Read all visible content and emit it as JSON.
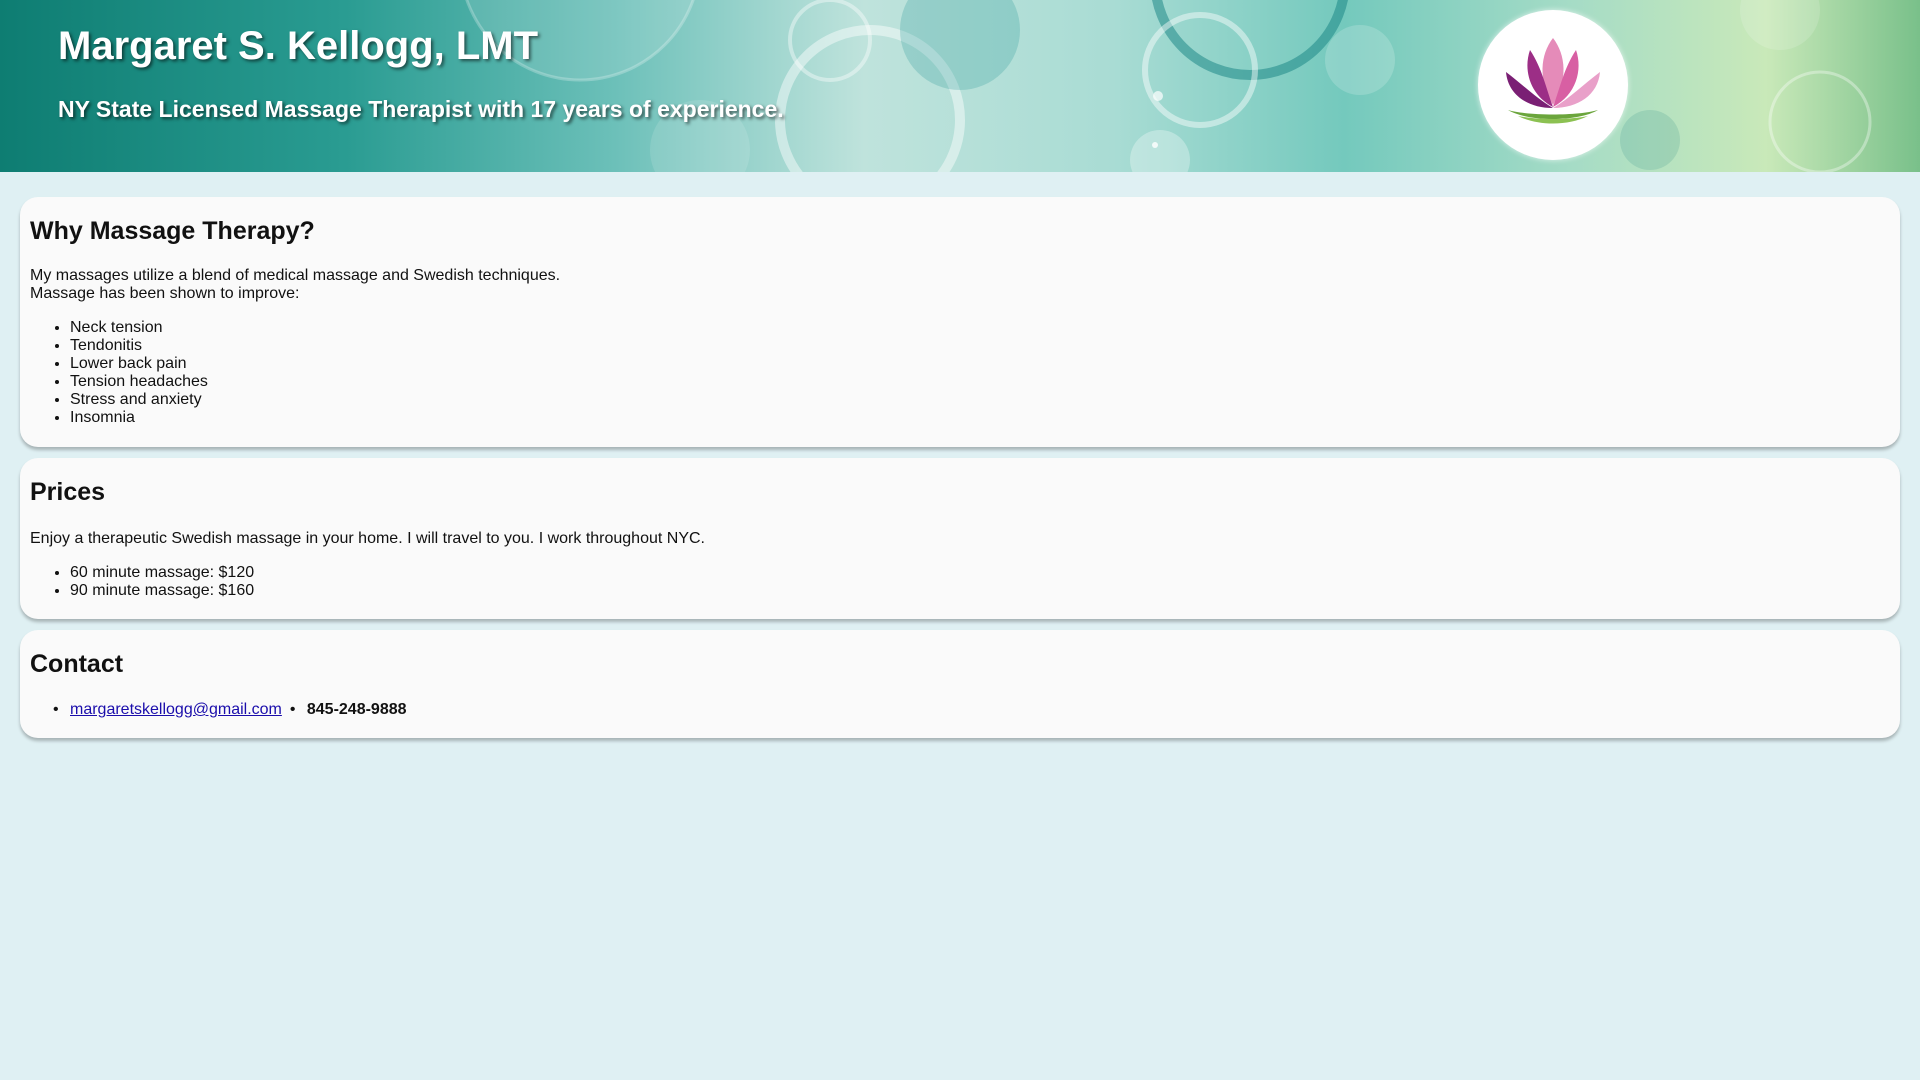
{
  "header": {
    "title": "Margaret S. Kellogg, LMT",
    "subtitle": "NY State Licensed Massage Therapist with 17 years of experience.",
    "logo_icon": "lotus-icon"
  },
  "why": {
    "heading": "Why Massage Therapy?",
    "intro_line1": "My massages utilize a blend of medical massage and Swedish techniques.",
    "intro_line2": "Massage has been shown to improve:",
    "benefits": [
      "Neck tension",
      "Tendonitis",
      "Lower back pain",
      "Tension headaches",
      "Stress and anxiety",
      "Insomnia"
    ]
  },
  "prices": {
    "heading": "Prices",
    "intro": "Enjoy a therapeutic Swedish massage in your home. I will travel to you. I work throughout NYC.",
    "items": [
      "60 minute massage: $120",
      "90 minute massage: $160"
    ]
  },
  "contact": {
    "heading": "Contact",
    "email": "margaretskellogg@gmail.com",
    "phone": "845-248-9888"
  },
  "colors": {
    "page_background": "#dff0f3",
    "card_background": "#fafafa",
    "link": "#1a0dab",
    "header_teal": "#0e7d72"
  }
}
